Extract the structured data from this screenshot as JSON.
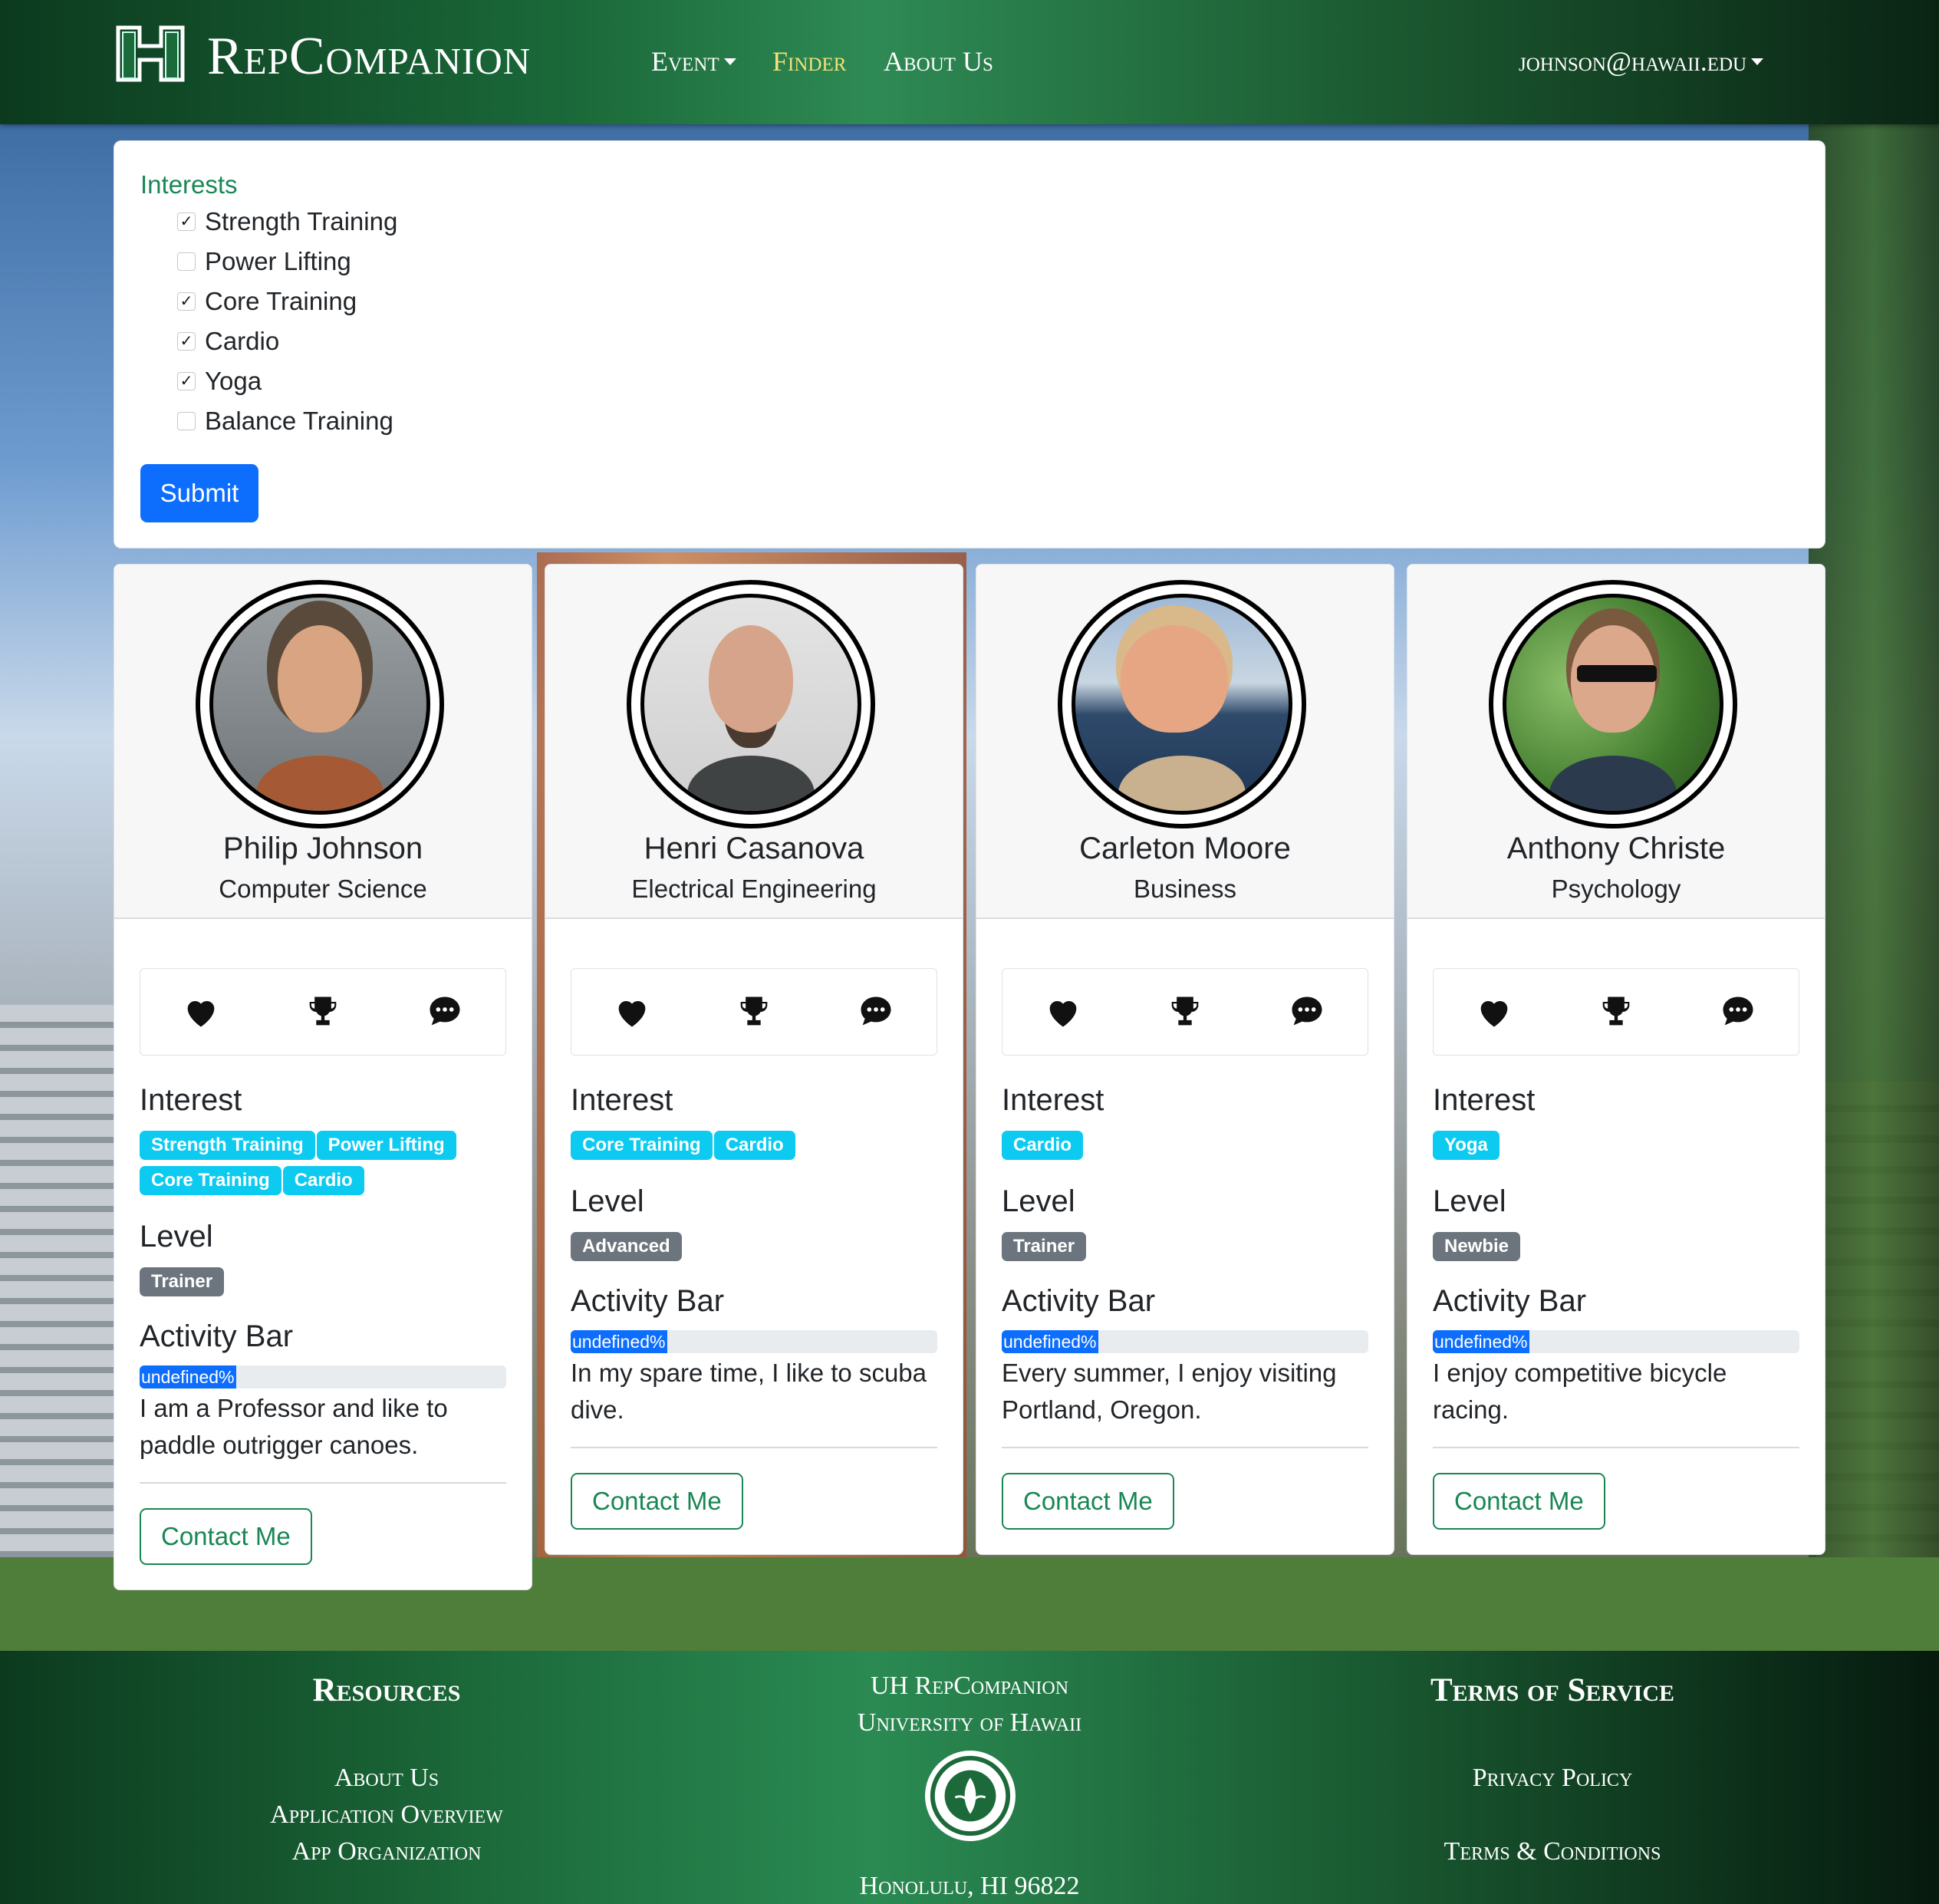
{
  "app": {
    "brand": "RepCompanion"
  },
  "nav": {
    "event": "Event",
    "finder": "Finder",
    "about": "About Us",
    "user": "johnson@hawaii.edu"
  },
  "filter": {
    "title": "Interests",
    "options": [
      {
        "label": "Strength Training",
        "checked": true
      },
      {
        "label": "Power Lifting",
        "checked": false
      },
      {
        "label": "Core Training",
        "checked": true
      },
      {
        "label": "Cardio",
        "checked": true
      },
      {
        "label": "Yoga",
        "checked": true
      },
      {
        "label": "Balance Training",
        "checked": false
      }
    ],
    "submit": "Submit"
  },
  "labels": {
    "interest": "Interest",
    "level": "Level",
    "activity": "Activity Bar",
    "contact": "Contact Me",
    "progress_text": "undefined%"
  },
  "profiles": [
    {
      "name": "Philip Johnson",
      "department": "Computer Science",
      "interests": [
        "Strength Training",
        "Power Lifting",
        "Core Training",
        "Cardio"
      ],
      "level": "Trainer",
      "bio": "I am a Professor and like to paddle outrigger canoes."
    },
    {
      "name": "Henri Casanova",
      "department": "Electrical Engineering",
      "interests": [
        "Core Training",
        "Cardio"
      ],
      "level": "Advanced",
      "bio": "In my spare time, I like to scuba dive."
    },
    {
      "name": "Carleton Moore",
      "department": "Business",
      "interests": [
        "Cardio"
      ],
      "level": "Trainer",
      "bio": "Every summer, I enjoy visiting Portland, Oregon."
    },
    {
      "name": "Anthony Christe",
      "department": "Psychology",
      "interests": [
        "Yoga"
      ],
      "level": "Newbie",
      "bio": "I enjoy competitive bicycle racing."
    }
  ],
  "footer": {
    "resources_title": "Resources",
    "resources_links": [
      "About Us",
      "Application Overview",
      "App Organization"
    ],
    "center_line1": "UH RepCompanion",
    "center_line2": "University of Hawaii",
    "center_address": "Honolulu, HI 96822",
    "tos_title": "Terms of Service",
    "tos_links": [
      "Privacy Policy",
      "Terms & Conditions"
    ]
  },
  "colors": {
    "primary": "#0d6efd",
    "success": "#198754",
    "info_badge": "#0dcaf0",
    "secondary_badge": "#6c757d",
    "nav_active": "#f4e27a"
  }
}
